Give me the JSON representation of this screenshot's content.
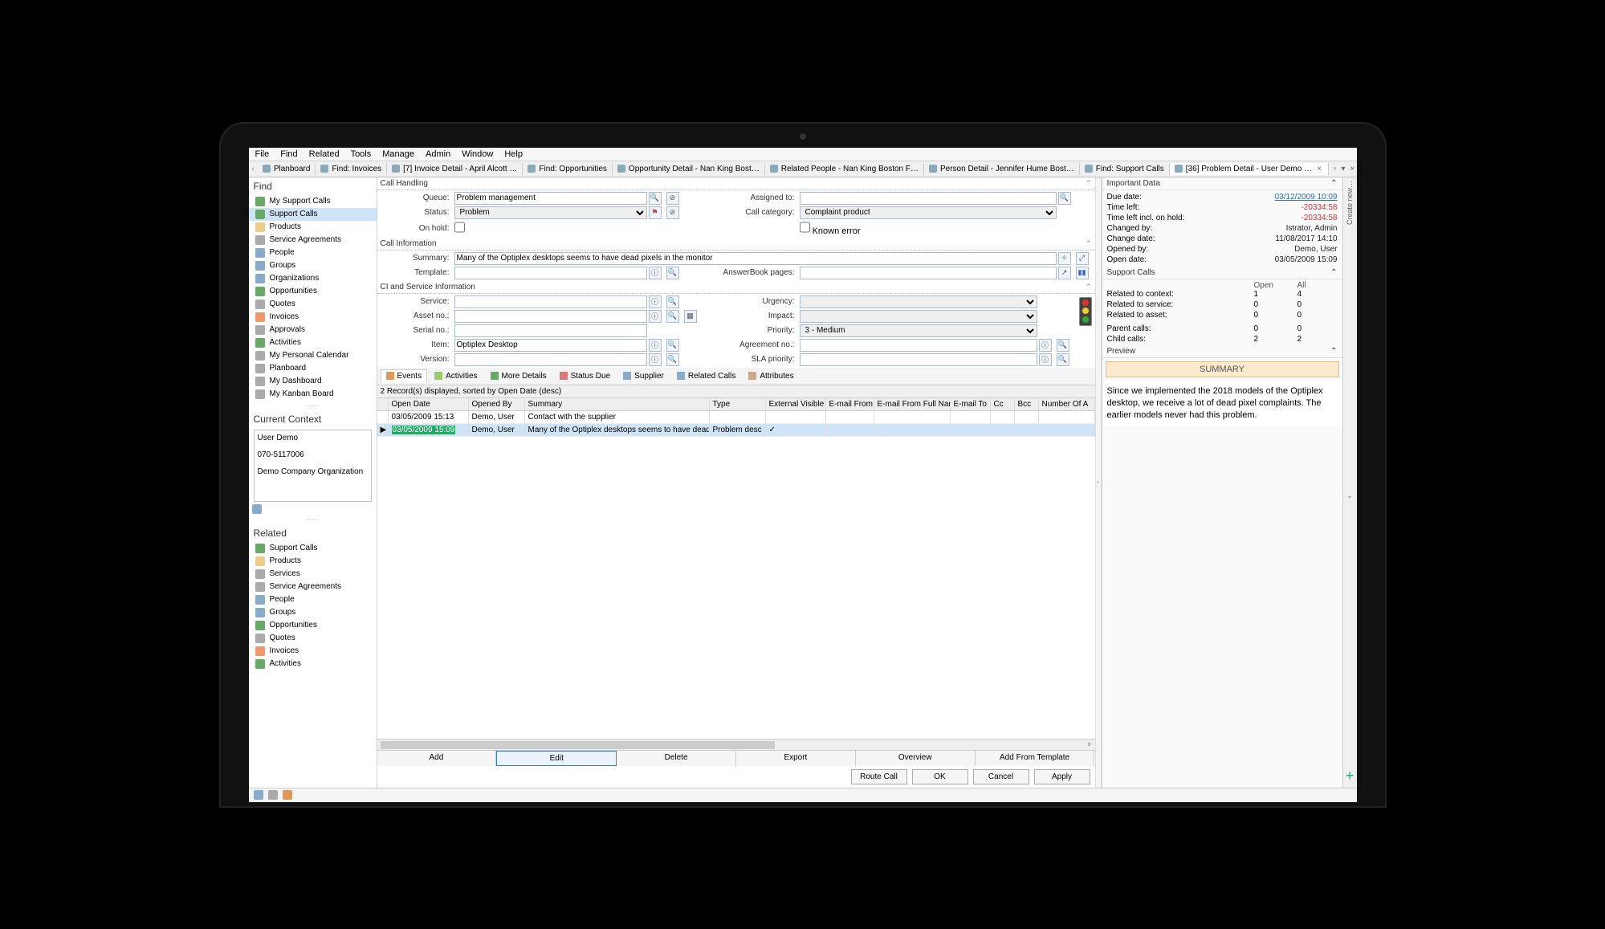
{
  "menu": [
    "File",
    "Find",
    "Related",
    "Tools",
    "Manage",
    "Admin",
    "Window",
    "Help"
  ],
  "tabs": [
    {
      "label": "Planboard"
    },
    {
      "label": "Find: Invoices"
    },
    {
      "label": "[7] Invoice Detail - April Alcott …"
    },
    {
      "label": "Find: Opportunities"
    },
    {
      "label": "Opportunity Detail - Nan King  Bost…"
    },
    {
      "label": "Related People - Nan King  Boston F…"
    },
    {
      "label": "Person Detail - Jennifer Hume  Bost…"
    },
    {
      "label": "Find: Support Calls"
    },
    {
      "label": "[36] Problem Detail - User Demo  …",
      "active": true
    }
  ],
  "find": {
    "title": "Find",
    "items": [
      {
        "label": "My Support Calls",
        "ico": "ni-green"
      },
      {
        "label": "Support Calls",
        "ico": "ni-green",
        "selected": true
      },
      {
        "label": "Products",
        "ico": "ni-yellow"
      },
      {
        "label": "Service Agreements",
        "ico": "ni-gray"
      },
      {
        "label": "People",
        "ico": "ni-blue"
      },
      {
        "label": "Groups",
        "ico": "ni-blue"
      },
      {
        "label": "Organizations",
        "ico": "ni-blue"
      },
      {
        "label": "Opportunities",
        "ico": "ni-green"
      },
      {
        "label": "Quotes",
        "ico": "ni-gray"
      },
      {
        "label": "Invoices",
        "ico": "ni-orange"
      },
      {
        "label": "Approvals",
        "ico": "ni-gray"
      },
      {
        "label": "Activities",
        "ico": "ni-green"
      },
      {
        "label": "My Personal Calendar",
        "ico": "ni-gray"
      },
      {
        "label": "Planboard",
        "ico": "ni-gray"
      },
      {
        "label": "My Dashboard",
        "ico": "ni-gray"
      },
      {
        "label": "My Kanban Board",
        "ico": "ni-gray"
      }
    ]
  },
  "context": {
    "title": "Current Context",
    "user": "User Demo",
    "phone": "070-5117006",
    "org": "Demo Company Organization"
  },
  "related": {
    "title": "Related",
    "items": [
      {
        "label": "Support Calls",
        "ico": "ni-green"
      },
      {
        "label": "Products",
        "ico": "ni-yellow"
      },
      {
        "label": "Services",
        "ico": "ni-gray"
      },
      {
        "label": "Service Agreements",
        "ico": "ni-gray"
      },
      {
        "label": "People",
        "ico": "ni-blue"
      },
      {
        "label": "Groups",
        "ico": "ni-blue"
      },
      {
        "label": "Opportunities",
        "ico": "ni-green"
      },
      {
        "label": "Quotes",
        "ico": "ni-gray"
      },
      {
        "label": "Invoices",
        "ico": "ni-orange"
      },
      {
        "label": "Activities",
        "ico": "ni-green"
      }
    ]
  },
  "sections": {
    "ch": "Call Handling",
    "ci": "Call Information",
    "csi": "CI and Service Information"
  },
  "form": {
    "queue_label": "Queue:",
    "queue": "Problem management",
    "assignedto_label": "Assigned to:",
    "assignedto": "",
    "status_label": "Status:",
    "status": "Problem",
    "callcat_label": "Call category:",
    "callcat": "Complaint product",
    "onhold_label": "On hold:",
    "knownerror_label": "Known error",
    "summary_label": "Summary:",
    "summary": "Many of the Optiplex desktops seems to have dead pixels in the monitor",
    "template_label": "Template:",
    "template": "",
    "answerbook_label": "AnswerBook pages:",
    "answerbook": "",
    "service_label": "Service:",
    "service": "",
    "urgency_label": "Urgency:",
    "urgency": "",
    "assetno_label": "Asset no.:",
    "assetno": "",
    "impact_label": "Impact:",
    "impact": "",
    "serialno_label": "Serial no.:",
    "serialno": "",
    "priority_label": "Priority:",
    "priority": "3 - Medium",
    "item_label": "Item:",
    "item": "Optiplex Desktop",
    "agreementno_label": "Agreement no.:",
    "agreementno": "",
    "version_label": "Version:",
    "version": "",
    "slapriority_label": "SLA priority:",
    "slapriority": ""
  },
  "subtabs": [
    "Events",
    "Activities",
    "More Details",
    "Status Due",
    "Supplier",
    "Related Calls",
    "Attributes"
  ],
  "grid": {
    "info": "2 Record(s) displayed, sorted by Open Date (desc)",
    "cols": [
      "Open Date",
      "Opened By",
      "Summary",
      "Type",
      "External Visible",
      "E-mail From",
      "E-mail From Full Name",
      "E-mail To",
      "Cc",
      "Bcc",
      "Number Of A"
    ],
    "rows": [
      {
        "date": "03/05/2009 15:13",
        "by": "Demo, User",
        "summary": "Contact with the supplier",
        "type": "",
        "ev": ""
      },
      {
        "date": "03/05/2009 15:09",
        "by": "Demo, User",
        "summary": "Many of the Optiplex desktops seems to have dead pixels in th",
        "type": "Problem desc",
        "ev": "✓",
        "sel": true
      }
    ]
  },
  "bottom": {
    "add": "Add",
    "edit": "Edit",
    "delete": "Delete",
    "export": "Export",
    "overview": "Overview",
    "addtpl": "Add From Template"
  },
  "ok": {
    "route": "Route Call",
    "ok": "OK",
    "cancel": "Cancel",
    "apply": "Apply"
  },
  "important": {
    "title": "Important Data",
    "rows": [
      {
        "k": "Due date:",
        "v": "03/12/2009 10:09",
        "link": true
      },
      {
        "k": "Time left:",
        "v": "-20334:58",
        "red": true
      },
      {
        "k": "Time left incl. on hold:",
        "v": "-20334:58",
        "red": true
      },
      {
        "k": "Changed by:",
        "v": "Istrator, Admin"
      },
      {
        "k": "Change date:",
        "v": "11/08/2017 14:10"
      },
      {
        "k": "Opened by:",
        "v": "Demo, User"
      },
      {
        "k": "Open date:",
        "v": "03/05/2009 15:09"
      }
    ]
  },
  "supportcalls": {
    "title": "Support Calls",
    "head": [
      "",
      "Open",
      "All"
    ],
    "rows": [
      {
        "k": "Related to context:",
        "o": "1",
        "a": "4",
        "link": true
      },
      {
        "k": "Related to service:",
        "o": "0",
        "a": "0"
      },
      {
        "k": "Related to asset:",
        "o": "0",
        "a": "0"
      }
    ],
    "rows2": [
      {
        "k": "Parent calls:",
        "o": "0",
        "a": "0"
      },
      {
        "k": "Child calls:",
        "o": "2",
        "a": "2",
        "link": true
      }
    ]
  },
  "preview": {
    "title": "Preview",
    "head": "SUMMARY",
    "body": "Since we implemented the 2018 models of the Optiplex desktop, we receive a lot of dead pixel complaints. The earlier models never had this problem."
  },
  "rightvert": {
    "text": "Create new…"
  }
}
